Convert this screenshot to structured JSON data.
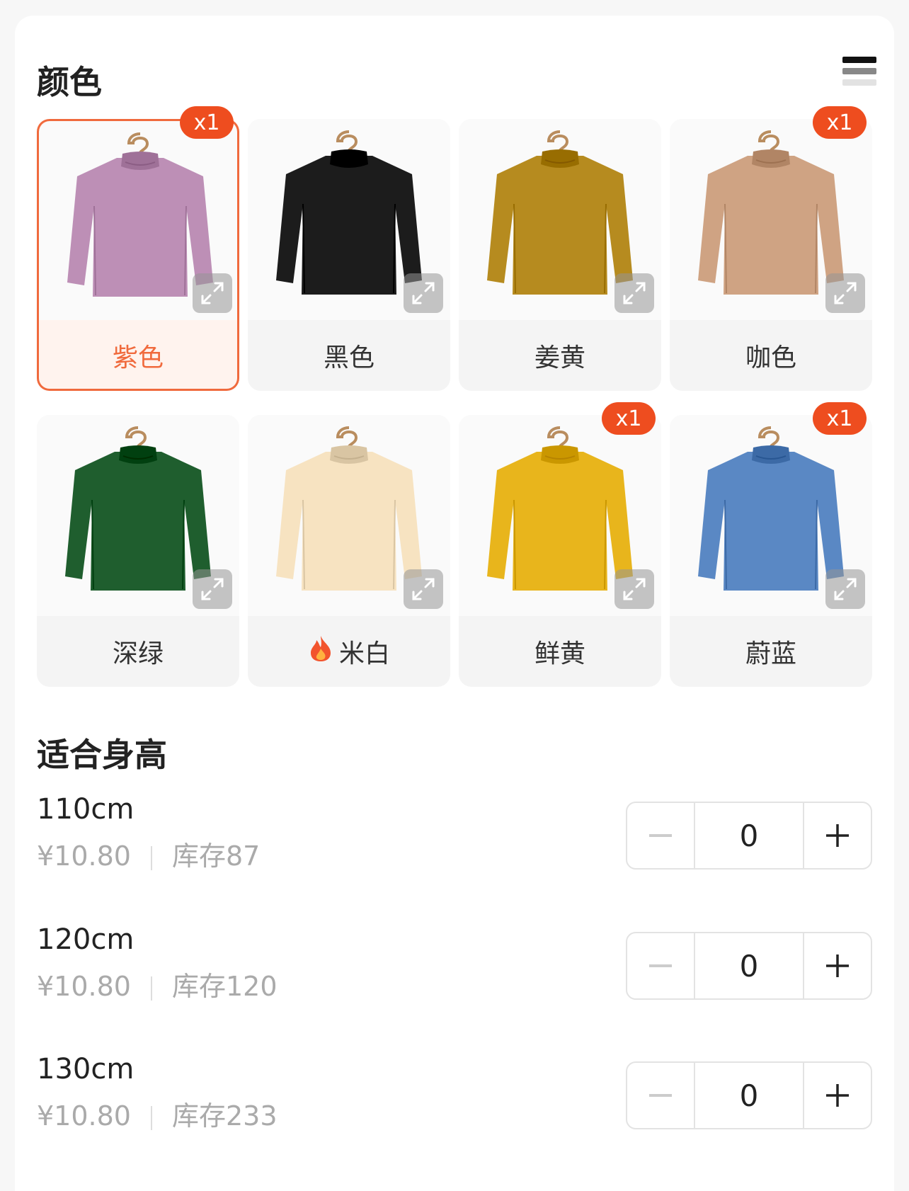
{
  "color_section": {
    "title": "颜色",
    "colors": [
      {
        "label": "紫色",
        "badge": "x1",
        "selected": true,
        "hex": "#bd8fb6",
        "hot": false
      },
      {
        "label": "黑色",
        "badge": "",
        "selected": false,
        "hex": "#1c1c1c",
        "hot": false
      },
      {
        "label": "姜黄",
        "badge": "",
        "selected": false,
        "hex": "#b68b1f",
        "hot": false
      },
      {
        "label": "咖色",
        "badge": "x1",
        "selected": false,
        "hex": "#cfa383",
        "hot": false
      },
      {
        "label": "深绿",
        "badge": "",
        "selected": false,
        "hex": "#1f5e2e",
        "hot": false
      },
      {
        "label": "米白",
        "badge": "",
        "selected": false,
        "hex": "#f7e3c1",
        "hot": true
      },
      {
        "label": "鲜黄",
        "badge": "x1",
        "selected": false,
        "hex": "#e8b51c",
        "hot": false
      },
      {
        "label": "蔚蓝",
        "badge": "x1",
        "selected": false,
        "hex": "#5a88c4",
        "hot": false
      }
    ]
  },
  "size_section": {
    "title": "适合身高",
    "sizes": [
      {
        "size": "110cm",
        "price": "¥10.80",
        "stock": "库存87",
        "qty": "0"
      },
      {
        "size": "120cm",
        "price": "¥10.80",
        "stock": "库存120",
        "qty": "0"
      },
      {
        "size": "130cm",
        "price": "¥10.80",
        "stock": "库存233",
        "qty": "0"
      }
    ]
  },
  "colors_ui": {
    "accent": "#f06a3d",
    "badge": "#ee4d1f"
  }
}
